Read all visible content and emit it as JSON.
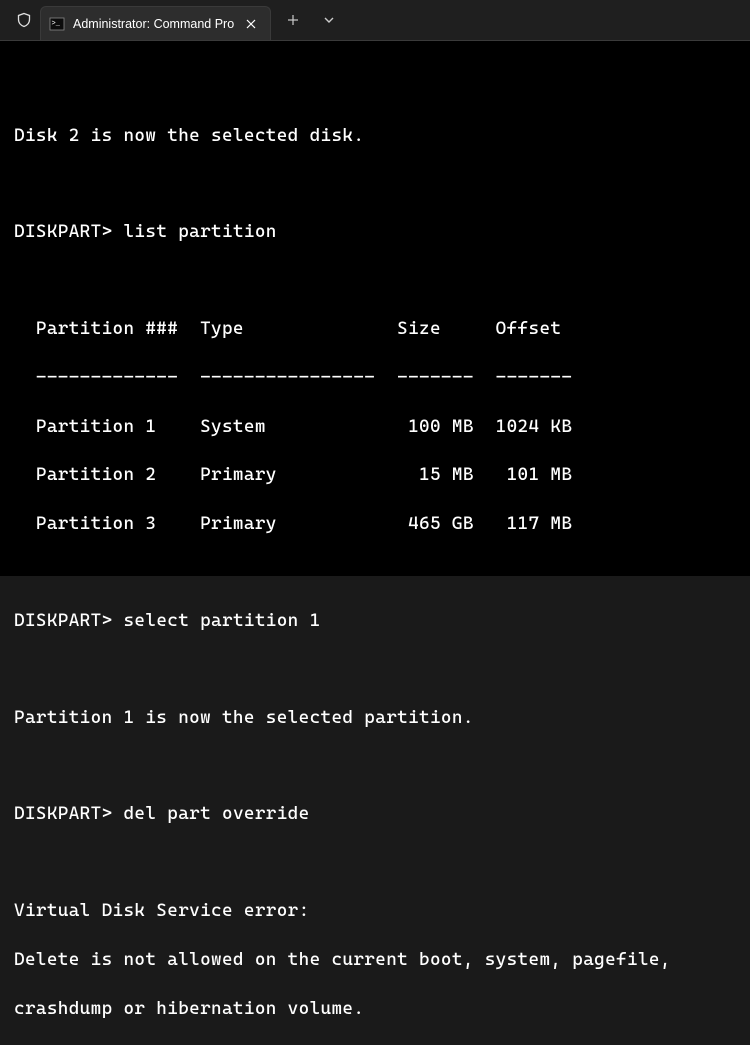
{
  "window": {
    "tab_title": "Administrator: Command Pro"
  },
  "terminal": {
    "msg_disk_selected": "Disk 2 is now the selected disk.",
    "prompt": "DISKPART>",
    "cmd_list_partition": "list partition",
    "table": {
      "header": "  Partition ###  Type              Size     Offset",
      "divider": "  -------------  ----------------  -------  -------",
      "row1": "  Partition 1    System             100 MB  1024 KB",
      "row2": "  Partition 2    Primary             15 MB   101 MB",
      "row3": "  Partition 3    Primary            465 GB   117 MB"
    },
    "cmd_select_partition": "select partition 1",
    "msg_partition_selected": "Partition 1 is now the selected partition.",
    "cmd_del_part": "del part override",
    "error_heading": "Virtual Disk Service error:",
    "error_line1": "Delete is not allowed on the current boot, system, pagefile,",
    "error_line2": "crashdump or hibernation volume."
  }
}
